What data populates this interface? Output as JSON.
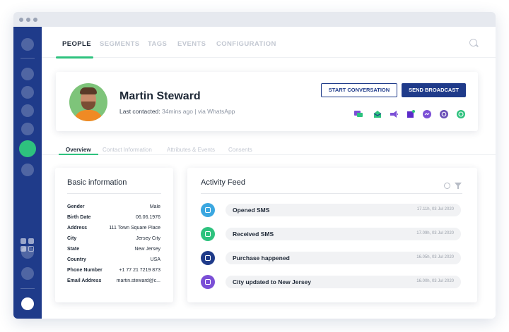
{
  "app": {
    "tabs": [
      {
        "label": "PEOPLE",
        "active": true
      },
      {
        "label": "SEGMENTS",
        "active": false
      },
      {
        "label": "TAGS",
        "active": false
      },
      {
        "label": "EVENTS",
        "active": false
      },
      {
        "label": "CONFIGURATION",
        "active": false
      }
    ]
  },
  "profile": {
    "name": "Martin Steward",
    "last_contacted_label": "Last contacted:",
    "last_contacted_value": "34mins ago",
    "separator": "|",
    "via": "via WhatsApp",
    "start_conversation": "START CONVERSATION",
    "send_broadcast": "SEND BROADCAST",
    "channel_icons": [
      "chat-bubbles-icon",
      "email-icon",
      "megaphone-icon",
      "cube-icon",
      "messenger-icon",
      "viber-icon",
      "whatsapp-icon"
    ]
  },
  "subtabs": [
    "Overview",
    "Contact Information",
    "Attributes & Events",
    "Consents"
  ],
  "basic_info": {
    "title": "Basic information",
    "rows": [
      {
        "label": "Gender",
        "value": "Male"
      },
      {
        "label": "Birth Date",
        "value": "06.06.1976"
      },
      {
        "label": "Address",
        "value": "111 Town Square Place"
      },
      {
        "label": "City",
        "value": "Jersey City"
      },
      {
        "label": "State",
        "value": "New Jersey"
      },
      {
        "label": "Country",
        "value": "USA"
      },
      {
        "label": "Phone Number",
        "value": "+1 77 21 7219 873"
      },
      {
        "label": "Email Address",
        "value": "martin.steward@c..."
      }
    ]
  },
  "activity": {
    "title": "Activity Feed",
    "items": [
      {
        "title": "Opened SMS",
        "time": "17.11h, 03 Jul 2020",
        "icon": "sms-icon",
        "color": "#3ba7e0"
      },
      {
        "title": "Received SMS",
        "time": "17.09h, 03 Jul 2020",
        "icon": "sms-icon",
        "color": "#2ec27e"
      },
      {
        "title": "Purchase happened",
        "time": "16.05h, 03 Jul 2020",
        "icon": "purchase-icon",
        "color": "#1f3b8a"
      },
      {
        "title": "City updated to New Jersey",
        "time": "16.00h, 03 Jul 2020",
        "icon": "location-icon",
        "color": "#7b4fd6"
      }
    ]
  },
  "colors": {
    "sidebar": "#1f3b8a",
    "accent_green": "#2ec27e",
    "primary_blue": "#1f3b8a"
  }
}
